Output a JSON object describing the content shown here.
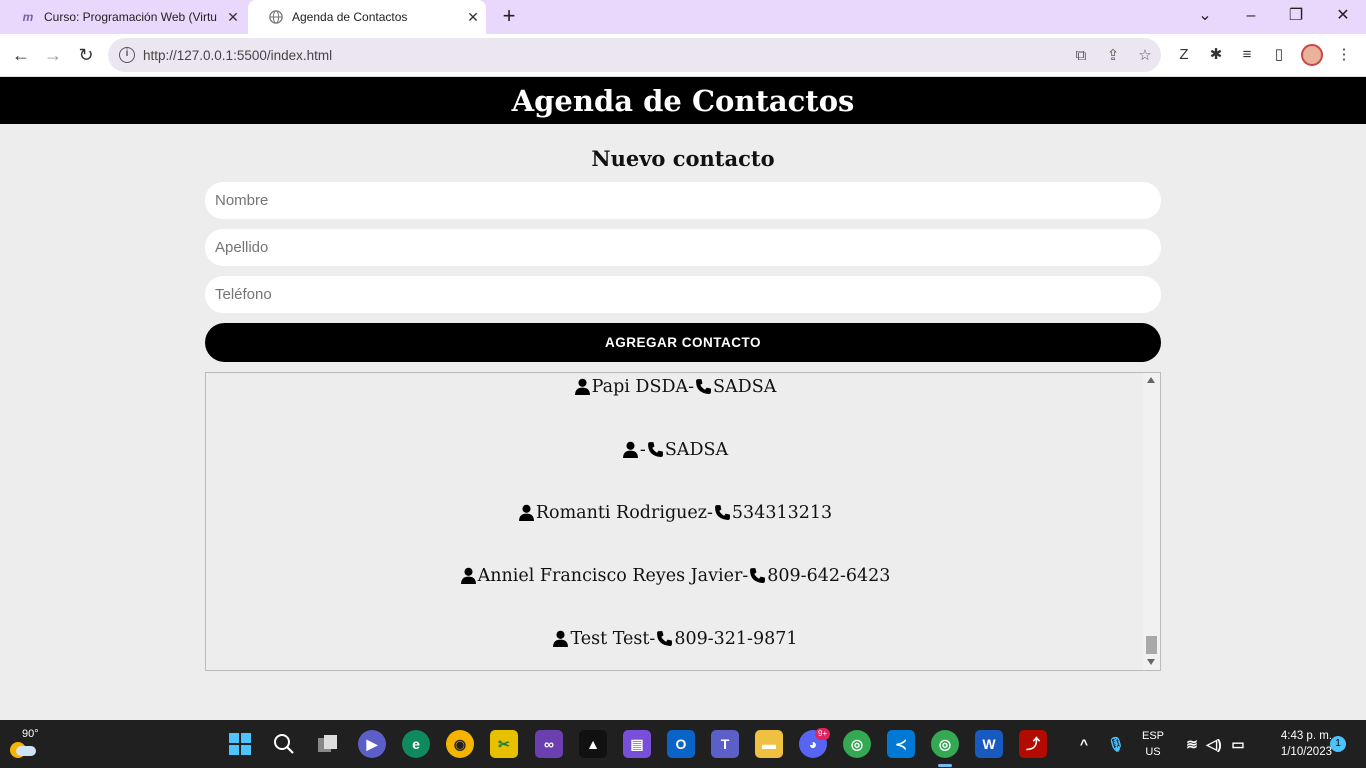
{
  "browser": {
    "tabs": [
      {
        "title": "Curso: Programación Web (Virtu",
        "favicon": "moodle-icon",
        "active": false
      },
      {
        "title": "Agenda de Contactos",
        "favicon": "globe-icon",
        "active": true
      }
    ],
    "url": "http://127.0.0.1:5500/index.html"
  },
  "page": {
    "header": "Agenda de Contactos",
    "form": {
      "title": "Nuevo contacto",
      "nombre_placeholder": "Nombre",
      "apellido_placeholder": "Apellido",
      "telefono_placeholder": "Teléfono",
      "submit_label": "AGREGAR CONTACTO"
    },
    "contacts": [
      {
        "name": "Papi DSDA",
        "separator": "-",
        "phone": "SADSA"
      },
      {
        "name": "",
        "separator": "-",
        "phone": "SADSA"
      },
      {
        "name": "Romanti Rodriguez",
        "separator": "-",
        "phone": "534313213"
      },
      {
        "name": "Anniel Francisco Reyes Javier",
        "separator": "-",
        "phone": "809-642-6423"
      },
      {
        "name": "Test Test",
        "separator": "-",
        "phone": "809-321-9871"
      }
    ]
  },
  "taskbar": {
    "weather_temp": "90°",
    "language": "ESP",
    "region": "US",
    "time": "4:43 p. m.",
    "date": "1/10/2023",
    "notifications": "1",
    "discord_badge": "9+"
  }
}
